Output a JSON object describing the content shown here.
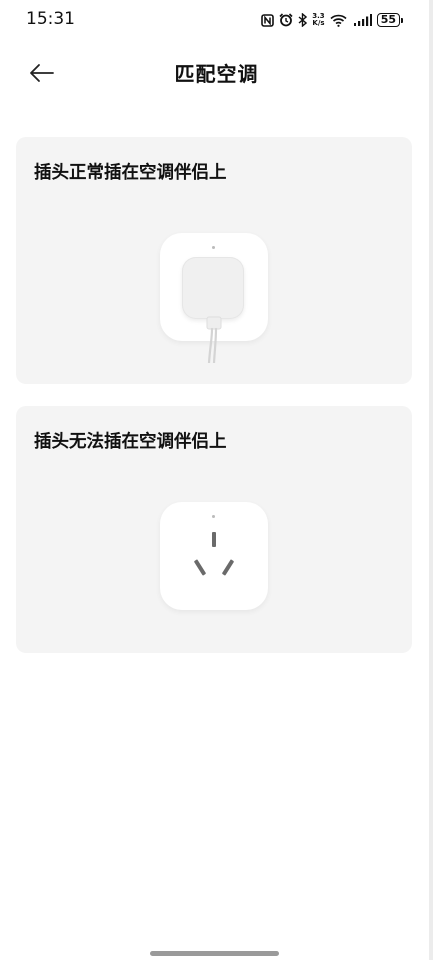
{
  "status_bar": {
    "time": "15:31",
    "net_speed_top": "3.3",
    "net_speed_bottom": "K/s",
    "battery": "55"
  },
  "header": {
    "title": "匹配空调"
  },
  "options": [
    {
      "title": "插头正常插在空调伴侣上"
    },
    {
      "title": "插头无法插在空调伴侣上"
    }
  ]
}
